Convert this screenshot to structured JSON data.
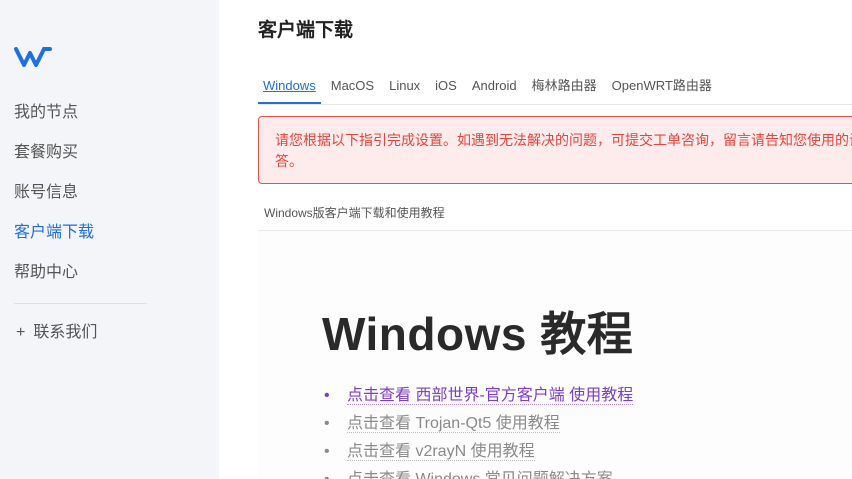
{
  "sidebar": {
    "logo_icon": "brand-w-logo-icon",
    "items": [
      {
        "label": "我的节点"
      },
      {
        "label": "套餐购买"
      },
      {
        "label": "账号信息"
      },
      {
        "label": "客户端下载",
        "active": true
      },
      {
        "label": "帮助中心"
      }
    ],
    "contact": {
      "icon": "plus-icon",
      "plus": "+",
      "label": "联系我们"
    }
  },
  "header": {
    "title": "客户端下载"
  },
  "tabs": [
    {
      "label": "Windows",
      "active": true
    },
    {
      "label": "MacOS"
    },
    {
      "label": "Linux"
    },
    {
      "label": "iOS"
    },
    {
      "label": "Android"
    },
    {
      "label": "梅林路由器"
    },
    {
      "label": "OpenWRT路由器"
    }
  ],
  "alert": {
    "line1": "请您根据以下指引完成设置。如遇到无法解决的问题，可提交工单咨询，留言请告知您使用的设",
    "line2": "答。"
  },
  "section": {
    "label": "Windows版客户端下载和使用教程"
  },
  "article": {
    "title": "Windows 教程",
    "bullet": "•",
    "items": [
      {
        "text": "点击查看 西部世界-官方客户端 使用教程",
        "visited": true
      },
      {
        "text": "点击查看 Trojan-Qt5 使用教程"
      },
      {
        "text": "点击查看 v2rayN 使用教程"
      },
      {
        "text": "点击查看 Windows 常见问题解决方案"
      }
    ]
  },
  "colors": {
    "accent": "#1f6fe0",
    "alert_text": "#e0463f",
    "alert_bg": "#fdeceb",
    "visited_link": "#7d3ec6"
  }
}
